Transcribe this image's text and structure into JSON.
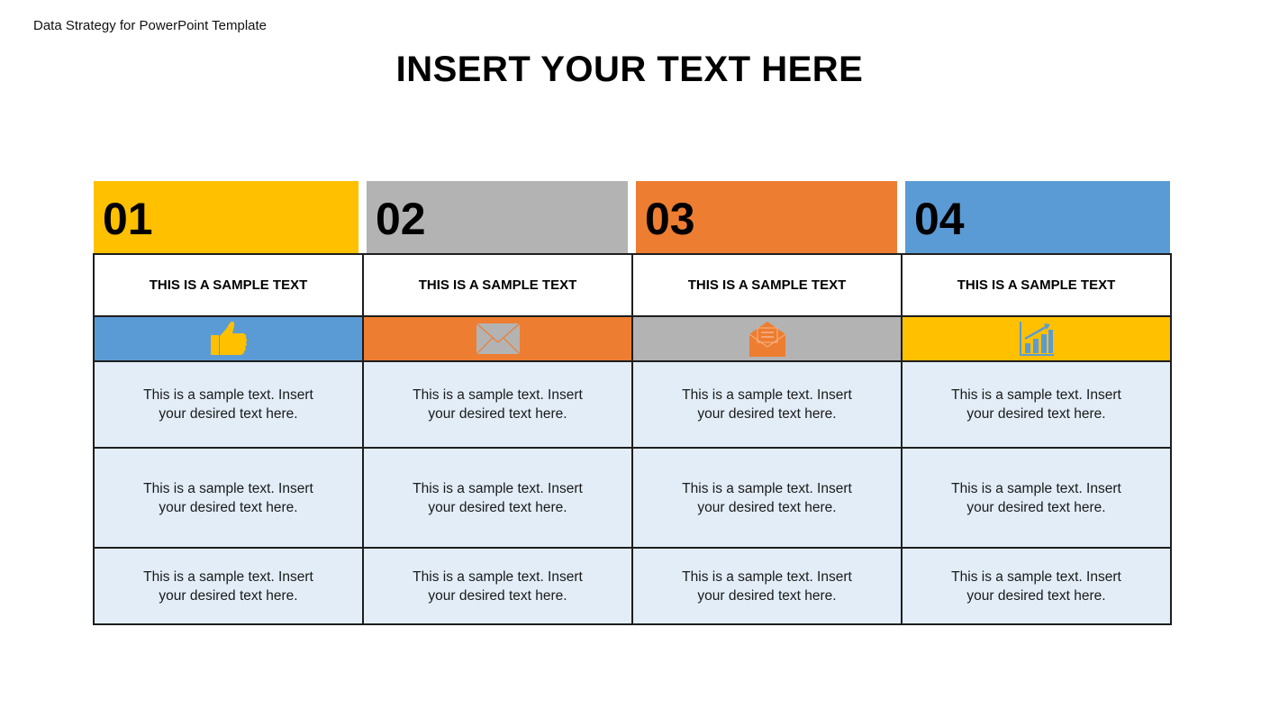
{
  "document": {
    "label": "Data Strategy for PowerPoint Template",
    "title": "INSERT YOUR TEXT HERE"
  },
  "columns": [
    {
      "number": "01",
      "header_color": "#FFC000",
      "subtitle": "THIS IS A SAMPLE TEXT",
      "icon": "thumbs-up-icon",
      "icon_band_color": "#5B9BD5",
      "icon_color": "#FFC000",
      "cells": [
        "This is a sample text. Insert your desired text here.",
        "This is a sample text. Insert your desired text here.",
        "This is a sample text. Insert your desired text here."
      ]
    },
    {
      "number": "02",
      "header_color": "#B3B3B3",
      "subtitle": "THIS IS A SAMPLE TEXT",
      "icon": "envelope-icon",
      "icon_band_color": "#ED7D31",
      "icon_color": "#B3B3B3",
      "cells": [
        "This is a sample text. Insert your desired text here.",
        "This is a sample text. Insert your desired text here.",
        "This is a sample text. Insert your desired text here."
      ]
    },
    {
      "number": "03",
      "header_color": "#ED7D31",
      "subtitle": "THIS IS A SAMPLE TEXT",
      "icon": "open-envelope-icon",
      "icon_band_color": "#B3B3B3",
      "icon_color": "#ED7D31",
      "cells": [
        "This is a sample text. Insert your desired text here.",
        "This is a sample text. Insert your desired text here.",
        "This is a sample text. Insert your desired text here."
      ]
    },
    {
      "number": "04",
      "header_color": "#5B9BD5",
      "subtitle": "THIS IS A SAMPLE TEXT",
      "icon": "growth-chart-icon",
      "icon_band_color": "#FFC000",
      "icon_color": "#5B9BD5",
      "cells": [
        "This is a sample text. Insert your desired text here.",
        "This is a sample text. Insert your desired text here.",
        "This is a sample text. Insert your desired text here."
      ]
    }
  ]
}
